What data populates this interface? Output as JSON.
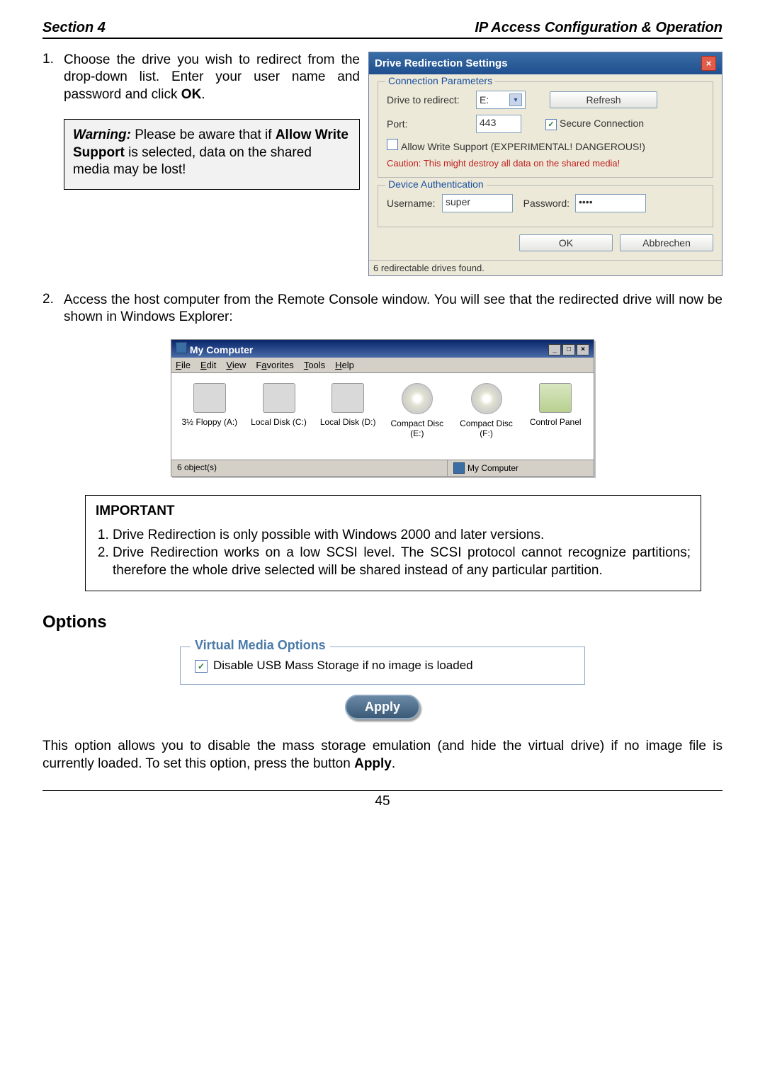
{
  "header": {
    "left": "Section 4",
    "right": "IP Access Configuration & Operation"
  },
  "step1": {
    "idx": "1.",
    "text_a": "Choose the drive you wish to redirect from the drop-down list. Enter your user name and password and click ",
    "text_b": "OK",
    "text_c": "."
  },
  "warn": {
    "label": "Warning:",
    "text_a": " Please be aware that if ",
    "bold1": "Allow Write Support",
    "text_b": " is selected, data on the shared media may be lost!"
  },
  "dialog": {
    "title": "Drive Redirection Settings",
    "group1": "Connection Parameters",
    "drive_lbl": "Drive to redirect:",
    "drive_val": "E:",
    "refresh": "Refresh",
    "port_lbl": "Port:",
    "port_val": "443",
    "secure": "Secure Connection",
    "allow": "Allow Write Support (EXPERIMENTAL! DANGEROUS!)",
    "caution": "Caution: This might destroy all data on the shared media!",
    "group2": "Device Authentication",
    "user_lbl": "Username:",
    "user_val": "super",
    "pass_lbl": "Password:",
    "pass_val": "••••",
    "ok": "OK",
    "cancel": "Abbrechen",
    "status": "6 redirectable drives found."
  },
  "step2": {
    "idx": "2.",
    "text": "Access the host computer from the Remote Console window. You will see that the redirected drive will now be shown in Windows Explorer:"
  },
  "explorer": {
    "title": "My Computer",
    "menu": [
      "File",
      "Edit",
      "View",
      "Favorites",
      "Tools",
      "Help"
    ],
    "menu_underline_idx": [
      0,
      0,
      0,
      1,
      0,
      0
    ],
    "items": [
      {
        "label": "3½ Floppy (A:)"
      },
      {
        "label": "Local Disk (C:)"
      },
      {
        "label": "Local Disk (D:)"
      },
      {
        "label": "Compact Disc (E:)"
      },
      {
        "label": "Compact Disc (F:)"
      },
      {
        "label": "Control Panel"
      }
    ],
    "status_left": "6 object(s)",
    "status_right": "My Computer"
  },
  "important": {
    "title": "IMPORTANT",
    "items": [
      "Drive Redirection is only possible with Windows 2000 and later versions.",
      "Drive Redirection works on a low SCSI level. The SCSI protocol cannot recognize partitions; therefore the whole drive selected will be shared instead of any particular partition."
    ]
  },
  "options": {
    "heading": "Options",
    "group": "Virtual Media Options",
    "checkbox": "Disable USB Mass Storage if no image is loaded",
    "apply": "Apply"
  },
  "closing": {
    "text_a": "This option allows you to disable the mass storage emulation (and hide the virtual drive) if no image file is currently loaded. To set this option, press the button ",
    "bold": "Apply",
    "text_b": "."
  },
  "footer": {
    "page": "45"
  }
}
